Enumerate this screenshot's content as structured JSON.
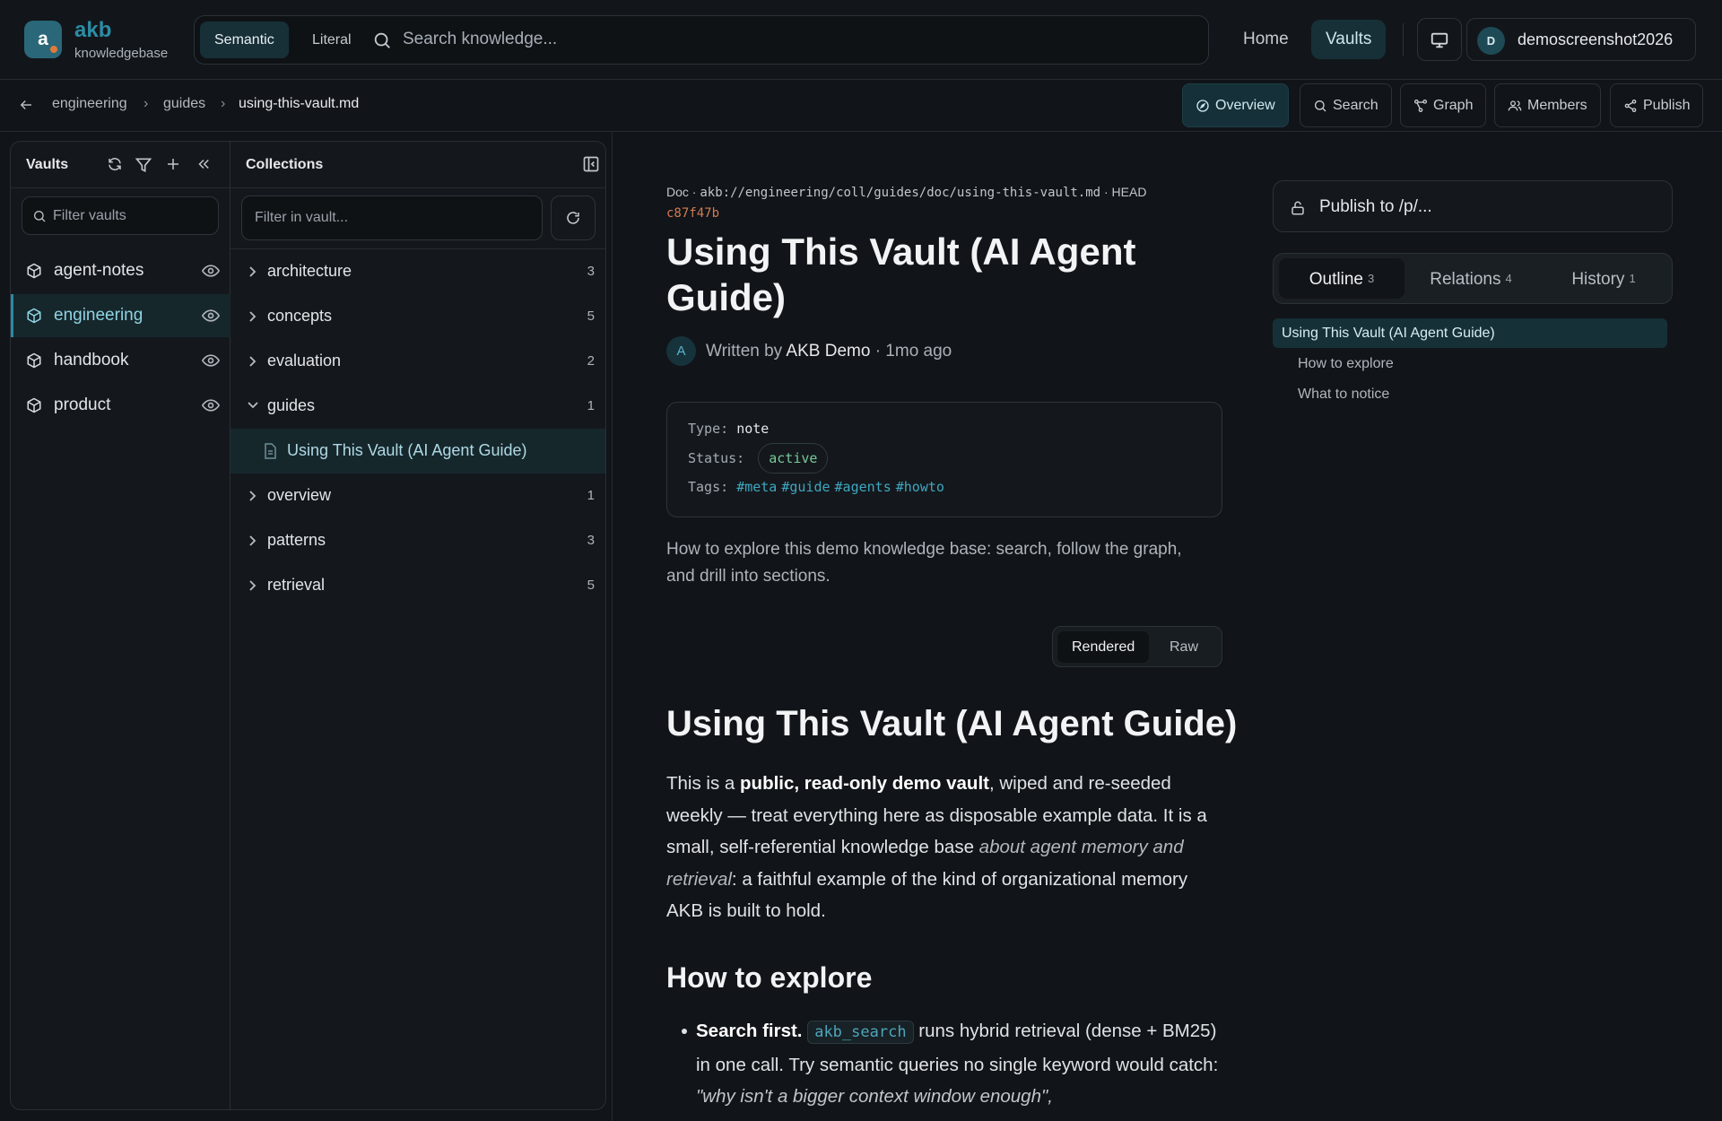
{
  "brand": {
    "mark": "a",
    "name": "akb",
    "sub": "knowledgebase"
  },
  "search": {
    "mode_semantic": "Semantic",
    "mode_literal": "Literal",
    "placeholder": "Search knowledge..."
  },
  "nav": {
    "home": "Home",
    "vaults": "Vaults"
  },
  "user": {
    "initial": "D",
    "name": "demoscreenshot2026"
  },
  "breadcrumb": [
    "engineering",
    "guides",
    "using-this-vault.md"
  ],
  "actions": {
    "overview": "Overview",
    "search": "Search",
    "graph": "Graph",
    "members": "Members",
    "publish": "Publish"
  },
  "vaults_panel": {
    "title": "Vaults",
    "filter_placeholder": "Filter vaults",
    "items": [
      {
        "label": "agent-notes"
      },
      {
        "label": "engineering",
        "selected": true
      },
      {
        "label": "handbook"
      },
      {
        "label": "product"
      }
    ]
  },
  "collections_panel": {
    "title": "Collections",
    "filter_placeholder": "Filter in vault...",
    "items": [
      {
        "label": "architecture",
        "count": "3"
      },
      {
        "label": "concepts",
        "count": "5"
      },
      {
        "label": "evaluation",
        "count": "2"
      },
      {
        "label": "guides",
        "count": "1",
        "expanded": true
      },
      {
        "label": "Using This Vault (AI Agent Guide)",
        "is_doc": true
      },
      {
        "label": "overview",
        "count": "1"
      },
      {
        "label": "patterns",
        "count": "3"
      },
      {
        "label": "retrieval",
        "count": "5"
      }
    ]
  },
  "doc": {
    "kind": "Doc",
    "uri": "akb://engineering/coll/guides/doc/using-this-vault.md",
    "ref": "HEAD",
    "hash": "c87f47b",
    "title": "Using This Vault (AI Agent Guide)",
    "author_initial": "A",
    "written_by": "Written by",
    "author": "AKB Demo",
    "age": "· 1mo ago",
    "frontmatter": {
      "type_key": "Type:",
      "type_val": "note",
      "status_key": "Status:",
      "status_val": "active",
      "tags_key": "Tags:",
      "tags": [
        "#meta",
        "#guide",
        "#agents",
        "#howto"
      ]
    },
    "summary": "How to explore this demo knowledge base: search, follow the graph, and drill into sections.",
    "view_rendered": "Rendered",
    "view_raw": "Raw",
    "h1": "Using This Vault (AI Agent Guide)",
    "para": {
      "p1": "This is a ",
      "b1": "public, read-only demo vault",
      "p2": ", wiped and re-seeded weekly — treat everything here as disposable example data. It is a small, self-referential knowledge base ",
      "i1": "about agent memory and retrieval",
      "p3": ": a faithful example of the kind of organizational memory AKB is built to hold."
    },
    "h2": "How to explore",
    "bullet": {
      "b1": "Search first.",
      "code": "akb_search",
      "p1": " runs hybrid retrieval (dense + BM25) in one call. Try semantic queries no single keyword would catch: ",
      "i1": "\"why isn't a bigger context window enough\","
    }
  },
  "sidebar": {
    "publish": "Publish to /p/...",
    "tabs": [
      {
        "label": "Outline",
        "count": "3"
      },
      {
        "label": "Relations",
        "count": "4"
      },
      {
        "label": "History",
        "count": "1"
      }
    ],
    "outline": [
      "Using This Vault (AI Agent Guide)",
      "How to explore",
      "What to notice"
    ]
  },
  "colors": {
    "accent": "#2a8aa3",
    "background": "#111418",
    "hash": "#d27c52",
    "status_active": "#77c99a"
  }
}
